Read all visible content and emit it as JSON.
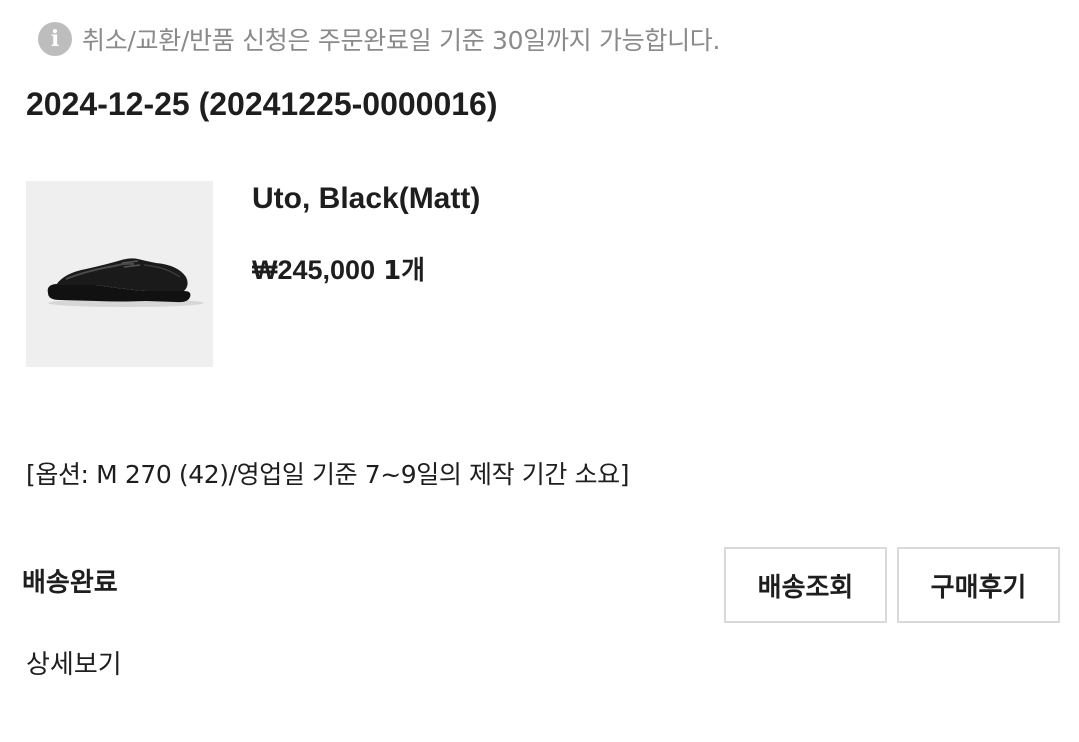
{
  "notice": {
    "icon": "info-icon",
    "icon_glyph": "i",
    "text": "취소/교환/반품 신청은 주문완료일 기준 30일까지 가능합니다."
  },
  "order": {
    "header": "2024-12-25 (20241225-0000016)"
  },
  "product": {
    "image_icon": "shoe-image",
    "name": "Uto, Black(Matt)",
    "price": "₩245,000",
    "quantity": "1개",
    "option": "[옵션: M 270 (42)/영업일 기준 7~9일의 제작 기간 소요]"
  },
  "status": {
    "label": "배송완료"
  },
  "actions": {
    "track_label": "배송조회",
    "review_label": "구매후기",
    "detail_label": "상세보기"
  },
  "colors": {
    "text": "#1e1e1e",
    "muted": "#8a8a8a",
    "icon_bg": "#bdbdbd",
    "image_bg": "#efefef",
    "button_border": "#d9d9d9"
  }
}
